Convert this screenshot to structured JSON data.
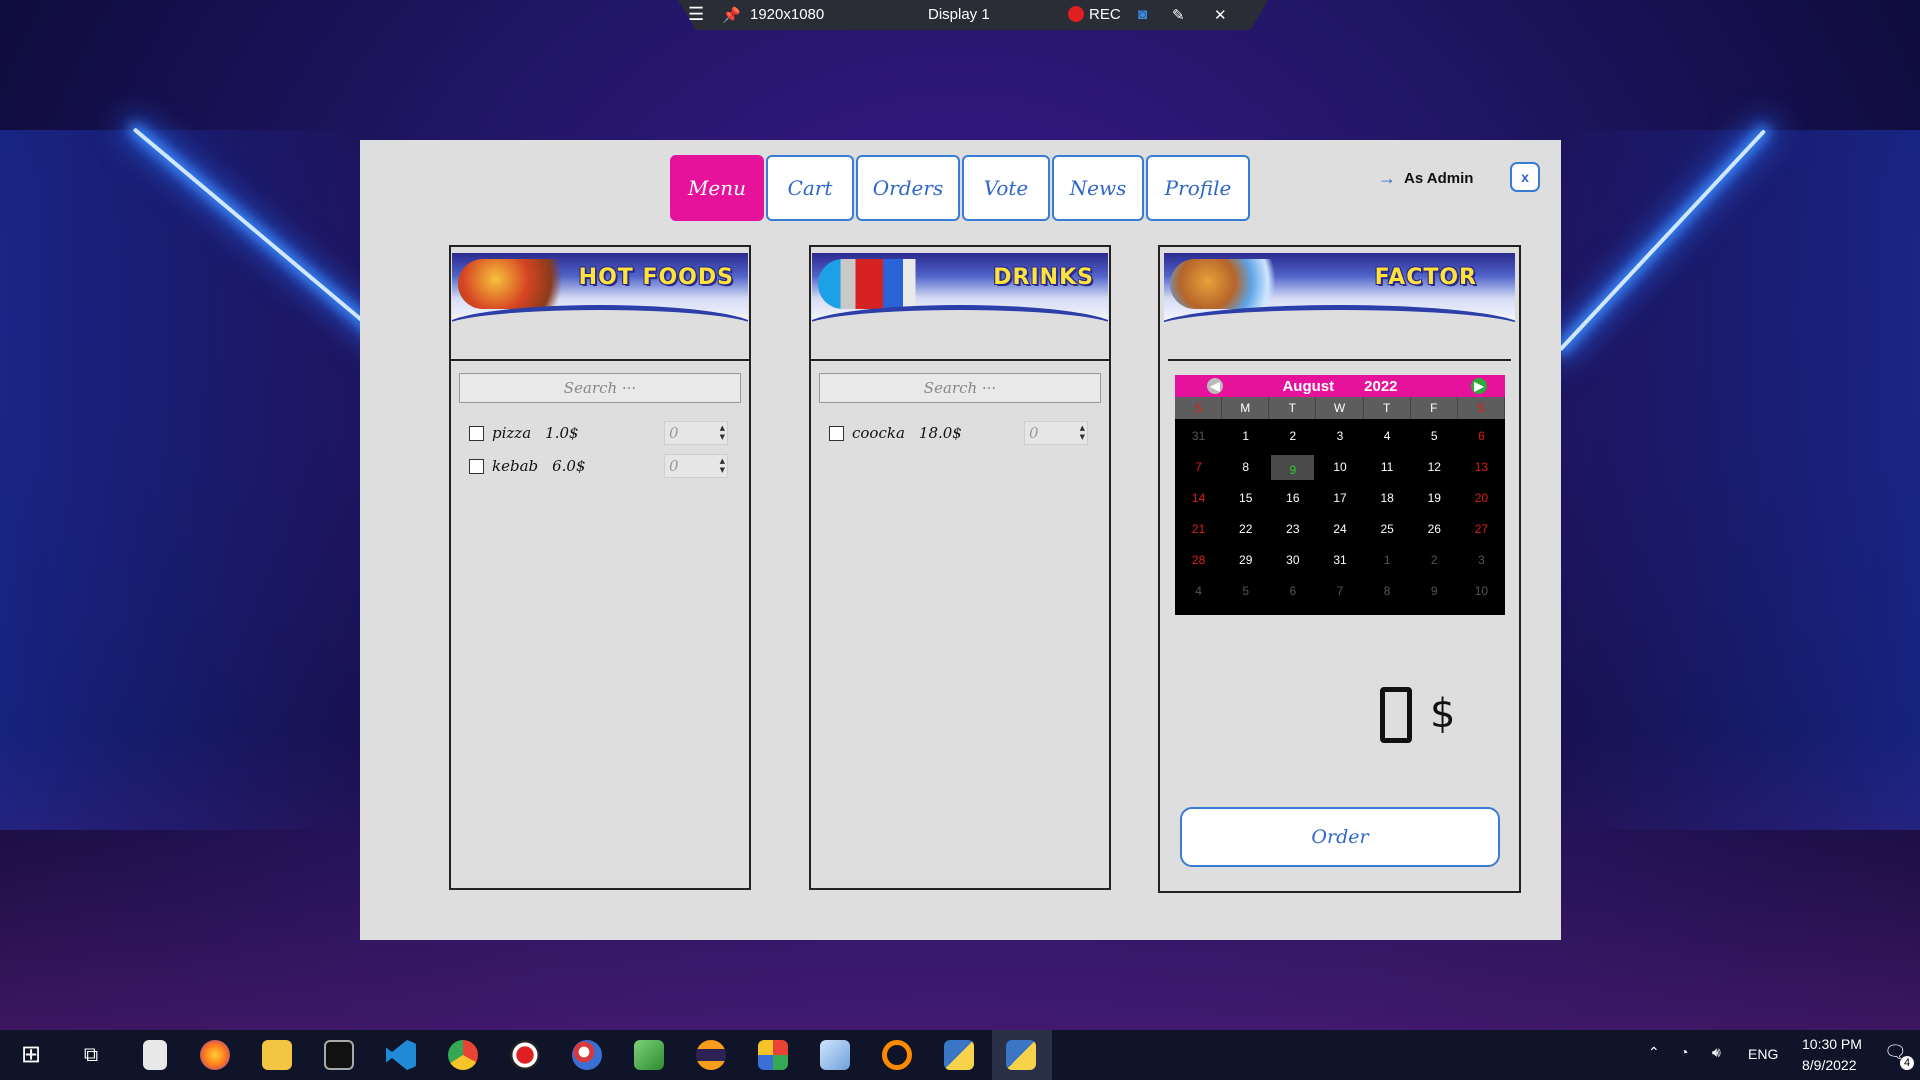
{
  "recorder": {
    "menu_icon": "hamburger-icon",
    "pin_icon": "pin-icon",
    "resolution": "1920x1080",
    "display": "Display 1",
    "rec_label": "REC",
    "camera_icon": "camera-icon",
    "pen_icon": "pen-icon",
    "close_icon": "close-icon"
  },
  "app": {
    "tabs": [
      {
        "label": "Menu",
        "active": true
      },
      {
        "label": "Cart",
        "active": false
      },
      {
        "label": "Orders",
        "active": false
      },
      {
        "label": "Vote",
        "active": false
      },
      {
        "label": "News",
        "active": false
      },
      {
        "label": "Profile",
        "active": false
      }
    ],
    "admin_label": "As Admin",
    "close_label": "x",
    "hot_foods": {
      "title": "HOT FOODS",
      "search_placeholder": "Search ···",
      "items": [
        {
          "name": "pizza",
          "price": "1.0$",
          "qty": "0"
        },
        {
          "name": "kebab",
          "price": "6.0$",
          "qty": "0"
        }
      ]
    },
    "drinks": {
      "title": "DRINKS",
      "search_placeholder": "Search ···",
      "items": [
        {
          "name": "coocka",
          "price": "18.0$",
          "qty": "0"
        }
      ]
    },
    "factor": {
      "title": "FACTOR",
      "calendar": {
        "month": "August",
        "year": "2022",
        "weekdays": [
          "S",
          "M",
          "T",
          "W",
          "T",
          "F",
          "S"
        ],
        "weeks": [
          [
            "31",
            "1",
            "2",
            "3",
            "4",
            "5",
            "6"
          ],
          [
            "7",
            "8",
            "9",
            "10",
            "11",
            "12",
            "13"
          ],
          [
            "14",
            "15",
            "16",
            "17",
            "18",
            "19",
            "20"
          ],
          [
            "21",
            "22",
            "23",
            "24",
            "25",
            "26",
            "27"
          ],
          [
            "28",
            "29",
            "30",
            "31",
            "1",
            "2",
            "3"
          ],
          [
            "4",
            "5",
            "6",
            "7",
            "8",
            "9",
            "10"
          ]
        ],
        "selected_day": "9"
      },
      "total": "0",
      "currency": "$",
      "order_label": "Order"
    },
    "colors": {
      "accent": "#e6129b",
      "border": "#3a7bd5"
    }
  },
  "taskbar": {
    "icons": [
      "windows-start-icon",
      "task-view-icon",
      "calculator-icon",
      "firefox-icon",
      "file-explorer-icon",
      "terminal-icon",
      "vscode-icon",
      "chrome-icon",
      "recorder-icon",
      "paint-icon",
      "photos-icon",
      "eclipse-icon",
      "office-icon",
      "virtualbox-icon",
      "headphones-app-icon",
      "python-idle-icon",
      "python-app-icon"
    ],
    "language": "ENG",
    "time": "10:30 PM",
    "date": "8/9/2022",
    "notification_count": "4"
  }
}
